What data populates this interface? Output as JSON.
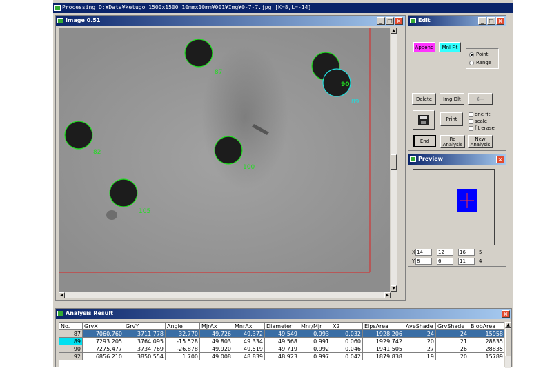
{
  "app": {
    "title": "Processing D:¥Data¥ketugo_1500x1500_10mmx10mm¥001¥Img¥0-7-7.jpg [K=8,L=-14]"
  },
  "image_window": {
    "title": "Image  0.51",
    "blobs": [
      {
        "label": "87",
        "color": "#22dd22"
      },
      {
        "label": "90",
        "color": "#22dd22"
      },
      {
        "label": "89",
        "color": "#22dddd"
      },
      {
        "label": "82",
        "color": "#22dd22"
      },
      {
        "label": "100",
        "color": "#22dd22"
      },
      {
        "label": "105",
        "color": "#22dd22"
      }
    ],
    "accent_colors": {
      "selection_box": "#dd2222",
      "blob_outline": "#22dd22",
      "selected_outline": "#22dddd"
    }
  },
  "edit_window": {
    "title": "Edit",
    "append_label": "Append",
    "mnlfit_label": "Mnl Fit",
    "point_label": "Point",
    "range_label": "Range",
    "delete_label": "Delete",
    "imgdlt_label": "Img Dlt",
    "print_label": "Print",
    "onefit_label": "one fit",
    "scale_label": "scale",
    "fiterase_label": "fit erase",
    "end_label": "End",
    "reanalysis_label": "Re Analysis",
    "newanalysis_label": "New Analysis",
    "mode_selected": "Point",
    "colors": {
      "append": "#ff33ff",
      "mnlfit": "#33ffff"
    }
  },
  "preview_window": {
    "title": "Preview",
    "x_label": "X",
    "y_label": "Y",
    "x_values": [
      "14",
      "12",
      "16"
    ],
    "x_extra": "5",
    "y_values": [
      "8",
      "6",
      "11"
    ],
    "y_extra": "4"
  },
  "result_window": {
    "title": "Analysis Result",
    "columns": [
      "No.",
      "GrvX",
      "GrvY",
      "Angle",
      "MjrAx",
      "MnrAx",
      "Diameter",
      "Mnr/Mjr",
      "X2",
      "ElpsArea",
      "AveShade",
      "GrvShade",
      "BlobArea"
    ],
    "rows": [
      [
        "87",
        "7060.760",
        "3711.778",
        "32.770",
        "49.726",
        "49.372",
        "49.549",
        "0.993",
        "0.032",
        "1928.206",
        "24",
        "24",
        "15958"
      ],
      [
        "89",
        "7293.205",
        "3764.095",
        "-15.528",
        "49.803",
        "49.334",
        "49.568",
        "0.991",
        "0.060",
        "1929.742",
        "20",
        "21",
        "28835"
      ],
      [
        "90",
        "7275.477",
        "3734.769",
        "-26.878",
        "49.920",
        "49.519",
        "49.719",
        "0.992",
        "0.046",
        "1941.505",
        "27",
        "26",
        "28835"
      ],
      [
        "92",
        "6856.210",
        "3850.554",
        "1.700",
        "49.008",
        "48.839",
        "48.923",
        "0.997",
        "0.042",
        "1879.838",
        "19",
        "20",
        "15789"
      ]
    ]
  }
}
